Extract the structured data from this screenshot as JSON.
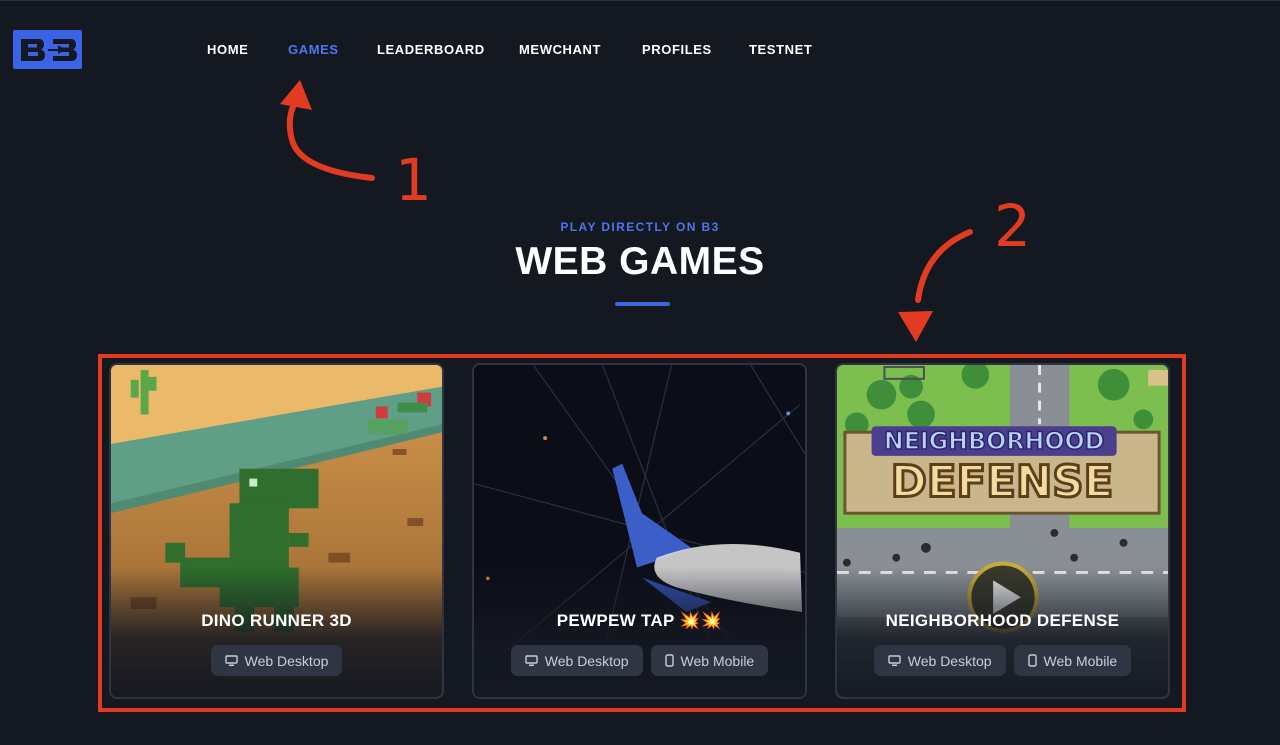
{
  "logo": {
    "text": "B3"
  },
  "nav": [
    {
      "label": "HOME",
      "active": false
    },
    {
      "label": "GAMES",
      "active": true
    },
    {
      "label": "LEADERBOARD",
      "active": false
    },
    {
      "label": "MEWCHANT",
      "active": false
    },
    {
      "label": "PROFILES",
      "active": false
    },
    {
      "label": "TESTNET",
      "active": false
    }
  ],
  "hero": {
    "kicker": "PLAY DIRECTLY ON B3",
    "title": "WEB GAMES"
  },
  "annotations": {
    "one": "1",
    "two": "2"
  },
  "games": [
    {
      "title": "DINO RUNNER 3D",
      "platforms": [
        {
          "label": "Web Desktop",
          "icon": "desktop-icon"
        }
      ]
    },
    {
      "title": "PEWPEW TAP 💥💥",
      "platforms": [
        {
          "label": "Web Desktop",
          "icon": "desktop-icon"
        },
        {
          "label": "Web Mobile",
          "icon": "mobile-icon"
        }
      ]
    },
    {
      "title": "NEIGHBORHOOD DEFENSE",
      "artwork_text": [
        "NEIGHBORHOOD",
        "DEFENSE"
      ],
      "platforms": [
        {
          "label": "Web Desktop",
          "icon": "desktop-icon"
        },
        {
          "label": "Web Mobile",
          "icon": "mobile-icon"
        }
      ]
    }
  ],
  "colors": {
    "background": "#141821",
    "accent": "#4d76ee",
    "annotation": "#e23b21",
    "tag_bg": "#2f3542"
  }
}
